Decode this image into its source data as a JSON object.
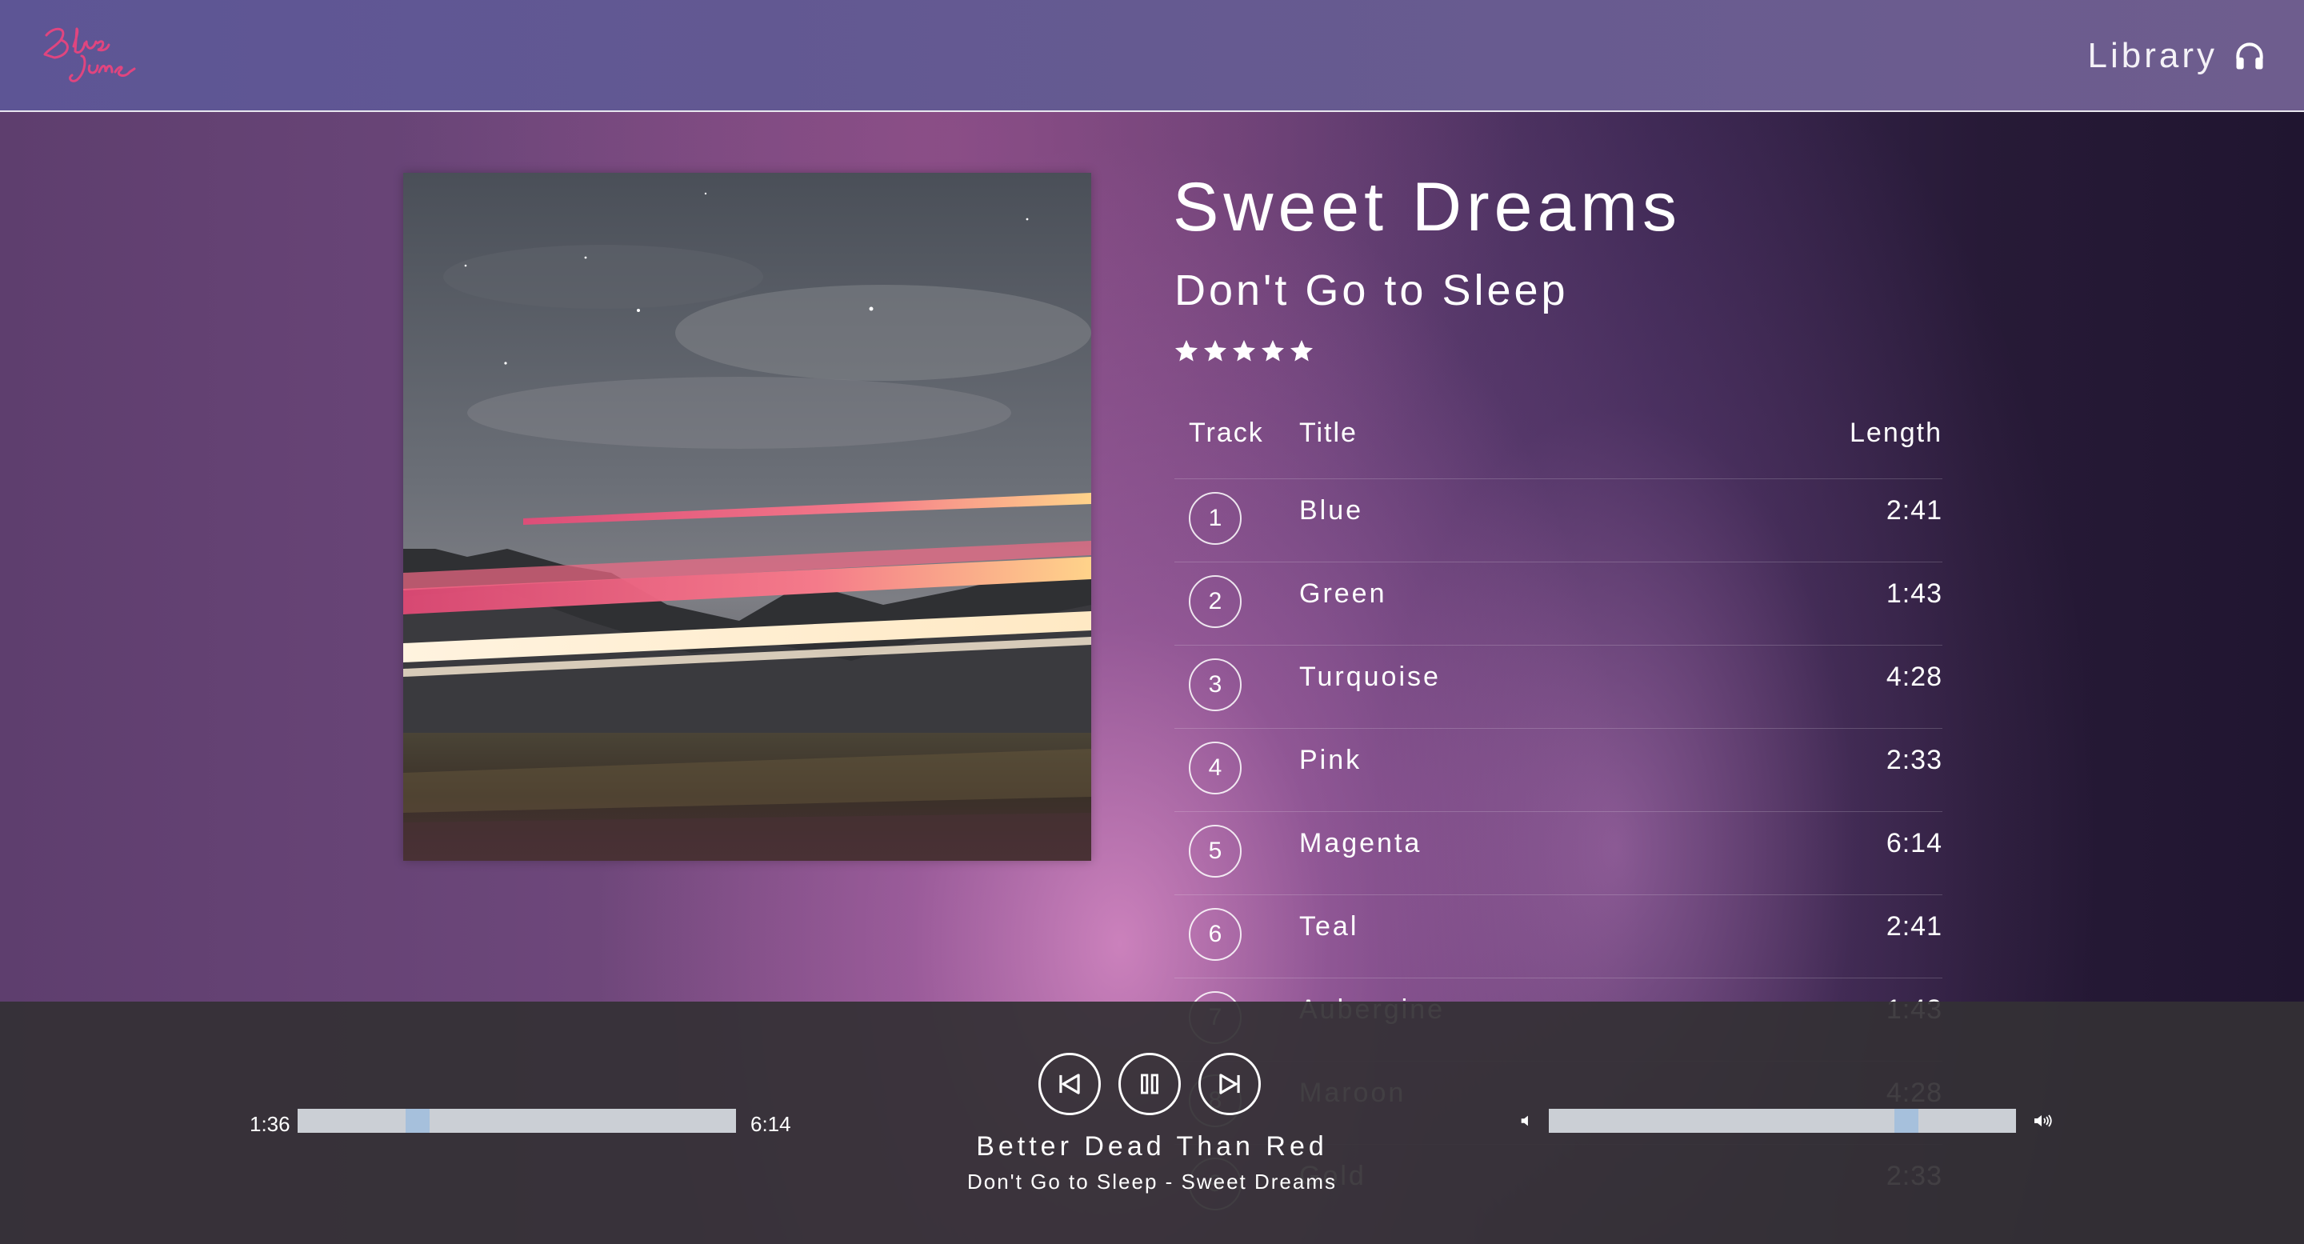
{
  "header": {
    "logo_text": "Blue Jams",
    "nav_label": "Library",
    "nav_icon": "headphones-icon"
  },
  "album": {
    "title": "Sweet Dreams",
    "artist": "Don't Go to Sleep",
    "rating": 5,
    "rating_max": 5
  },
  "tracklist": {
    "columns": {
      "track": "Track",
      "title": "Title",
      "length": "Length"
    },
    "tracks": [
      {
        "number": "1",
        "title": "Blue",
        "length": "2:41"
      },
      {
        "number": "2",
        "title": "Green",
        "length": "1:43"
      },
      {
        "number": "3",
        "title": "Turquoise",
        "length": "4:28"
      },
      {
        "number": "4",
        "title": "Pink",
        "length": "2:33"
      },
      {
        "number": "5",
        "title": "Magenta",
        "length": "6:14"
      },
      {
        "number": "6",
        "title": "Teal",
        "length": "2:41"
      },
      {
        "number": "7",
        "title": "Aubergine",
        "length": "1:43"
      },
      {
        "number": "8",
        "title": "Maroon",
        "length": "4:28"
      },
      {
        "number": "9",
        "title": "Gold",
        "length": "2:33"
      }
    ]
  },
  "player": {
    "current_time": "1:36",
    "total_time": "6:14",
    "progress_fraction": 0.26,
    "now_playing_title": "Better Dead Than Red",
    "now_playing_subtitle": "Don't Go to Sleep - Sweet Dreams",
    "volume_fraction": 0.78,
    "controls": [
      "previous-icon",
      "pause-icon",
      "next-icon"
    ]
  },
  "colors": {
    "header_bg": "#655a91",
    "player_bg": "#343035",
    "bar_track": "#cbcfd5",
    "bar_handle": "#a6c0dc",
    "logo_pink": "#e0457f"
  }
}
